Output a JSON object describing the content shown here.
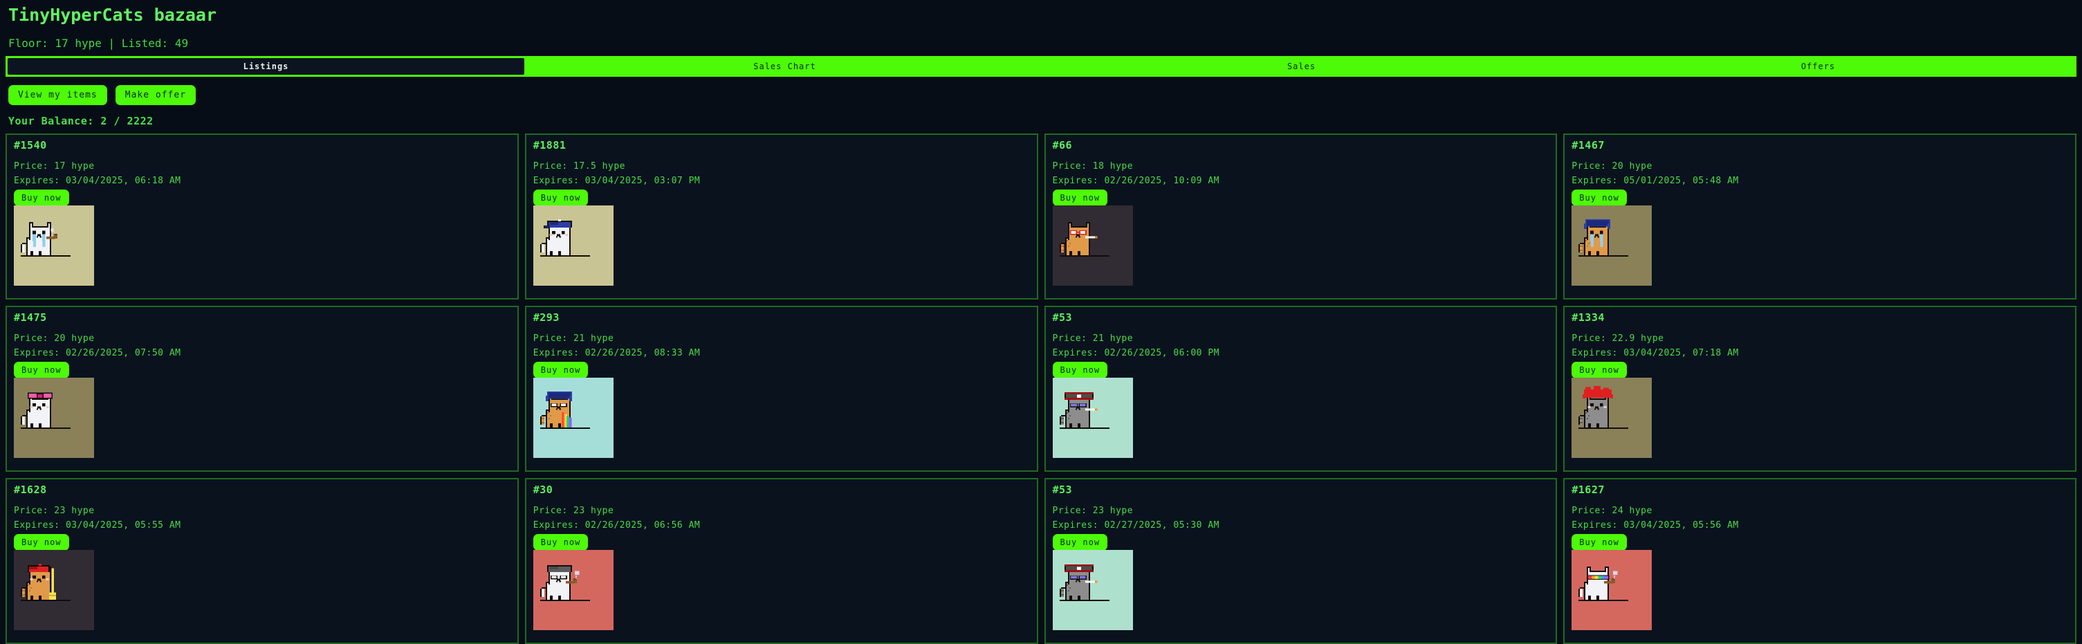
{
  "app": {
    "title": "TinyHyperCats bazaar",
    "stats": "Floor: 17 hype | Listed: 49",
    "balance": "Your Balance: 2 / 2222"
  },
  "colors": {
    "accent": "#4dfa08",
    "text": "#4dff4d",
    "background": "#060d16",
    "card_border": "#1f6b1f"
  },
  "tabs": [
    {
      "label": "Listings",
      "active": true
    },
    {
      "label": "Sales Chart",
      "active": false
    },
    {
      "label": "Sales",
      "active": false
    },
    {
      "label": "Offers",
      "active": false
    }
  ],
  "actions": [
    {
      "label": "View my items",
      "name": "view-my-items-button"
    },
    {
      "label": "Make offer",
      "name": "make-offer-button"
    }
  ],
  "buy_label": "Buy now",
  "listings": [
    {
      "id": "#1540",
      "price": "Price: 17 hype",
      "expires": "Expires: 03/04/2025, 06:18 AM",
      "bg": "#c9c493",
      "art": "white-cat-with-pipe"
    },
    {
      "id": "#1881",
      "price": "Price: 17.5 hype",
      "expires": "Expires: 03/04/2025, 03:07 PM",
      "bg": "#c9c493",
      "art": "white-cat-blue-cap"
    },
    {
      "id": "#66",
      "price": "Price: 18 hype",
      "expires": "Expires: 02/26/2025, 10:09 AM",
      "bg": "#312b33",
      "art": "orange-cat-red-glasses-cigarette"
    },
    {
      "id": "#1467",
      "price": "Price: 20 hype",
      "expires": "Expires: 05/01/2025, 05:48 AM",
      "bg": "#8a8159",
      "art": "orange-cat-blue-hair-crying"
    },
    {
      "id": "#1475",
      "price": "Price: 20 hype",
      "expires": "Expires: 02/26/2025, 07:50 AM",
      "bg": "#8a8159",
      "art": "white-cat-pink-bow"
    },
    {
      "id": "#293",
      "price": "Price: 21 hype",
      "expires": "Expires: 02/26/2025, 08:33 AM",
      "bg": "#a5ded8",
      "art": "orange-cat-blue-hair-rainbow"
    },
    {
      "id": "#53",
      "price": "Price: 21 hype",
      "expires": "Expires: 02/26/2025, 06:00 PM",
      "bg": "#aee0ce",
      "art": "grey-cat-pirate-hat-cigarette"
    },
    {
      "id": "#1334",
      "price": "Price: 22.9 hype",
      "expires": "Expires: 03/04/2025, 07:18 AM",
      "bg": "#8a8159",
      "art": "grey-cat-red-hair"
    },
    {
      "id": "#1628",
      "price": "Price: 23 hype",
      "expires": "Expires: 03/04/2025, 05:55 AM",
      "bg": "#312b33",
      "art": "orange-cat-red-cap-broom"
    },
    {
      "id": "#30",
      "price": "Price: 23 hype",
      "expires": "Expires: 02/26/2025, 06:56 AM",
      "bg": "#d4685f",
      "art": "white-cat-grey-cap-pipe"
    },
    {
      "id": "#53",
      "price": "Price: 23 hype",
      "expires": "Expires: 02/27/2025, 05:30 AM",
      "bg": "#aee0ce",
      "art": "grey-cat-pirate-hat-cigarette"
    },
    {
      "id": "#1627",
      "price": "Price: 24 hype",
      "expires": "Expires: 03/04/2025, 05:56 AM",
      "bg": "#d4685f",
      "art": "white-cat-rainbow-visor-pipe"
    }
  ]
}
